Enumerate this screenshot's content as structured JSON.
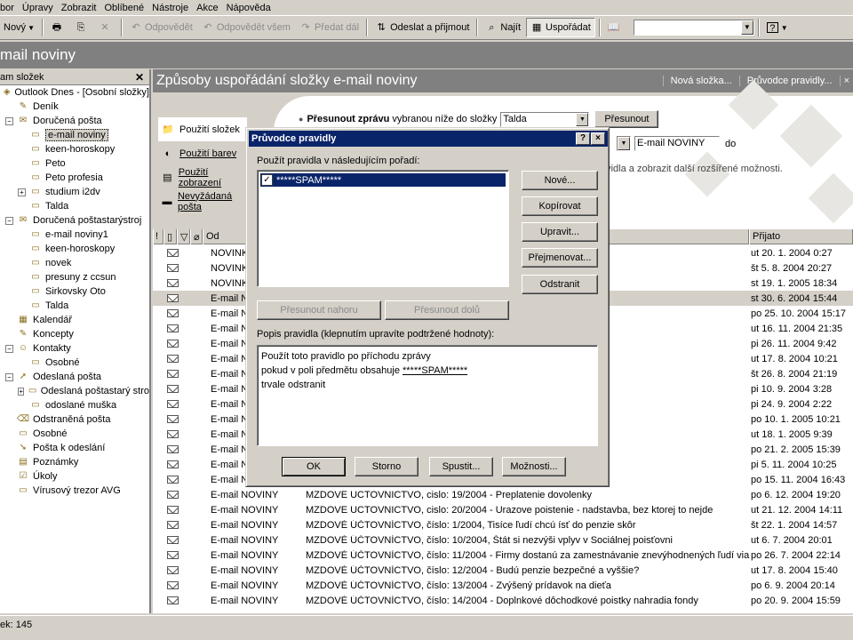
{
  "menu": [
    "bor",
    "Úpravy",
    "Zobrazit",
    "Oblíbené",
    "Nástroje",
    "Akce",
    "Nápověda"
  ],
  "toolbar": {
    "new": "Nový",
    "reply": "Odpovědět",
    "reply_all": "Odpovědět všem",
    "forward": "Předat dál",
    "send_receive": "Odeslat a přijmout",
    "find": "Najít",
    "organize": "Uspořádat"
  },
  "window_title": "mail noviny",
  "folder_pane": {
    "header": "am složek",
    "items": [
      {
        "label": "Outlook Dnes - [Osobní složky]",
        "indent": 0,
        "icon": "outlook-today-icon"
      },
      {
        "label": "Deník",
        "indent": 1,
        "icon": "journal-icon"
      },
      {
        "label": "Doručená pošta",
        "indent": 1,
        "icon": "inbox-icon",
        "expander": "−"
      },
      {
        "label": "e-mail noviny",
        "indent": 2,
        "icon": "folder-icon",
        "selected": true
      },
      {
        "label": "keen-horoskopy",
        "indent": 2,
        "icon": "folder-icon"
      },
      {
        "label": "Peto",
        "indent": 2,
        "icon": "folder-icon"
      },
      {
        "label": "Peto profesia",
        "indent": 2,
        "icon": "folder-icon"
      },
      {
        "label": "studium i2dv",
        "indent": 2,
        "icon": "folder-icon",
        "expander": "+"
      },
      {
        "label": "Talda",
        "indent": 2,
        "icon": "folder-icon"
      },
      {
        "label": "Doručená poštastarýstroj",
        "indent": 1,
        "icon": "inbox-icon",
        "expander": "−"
      },
      {
        "label": "e-mail noviny1",
        "indent": 2,
        "icon": "folder-icon"
      },
      {
        "label": "keen-horoskopy",
        "indent": 2,
        "icon": "folder-icon"
      },
      {
        "label": "novek",
        "indent": 2,
        "icon": "folder-icon"
      },
      {
        "label": "presuny z ccsun",
        "indent": 2,
        "icon": "folder-icon"
      },
      {
        "label": "Sirkovsky Oto",
        "indent": 2,
        "icon": "folder-icon"
      },
      {
        "label": "Talda",
        "indent": 2,
        "icon": "folder-icon"
      },
      {
        "label": "Kalendář",
        "indent": 1,
        "icon": "calendar-icon"
      },
      {
        "label": "Koncepty",
        "indent": 1,
        "icon": "drafts-icon"
      },
      {
        "label": "Kontakty",
        "indent": 1,
        "icon": "contacts-icon",
        "expander": "−"
      },
      {
        "label": "Osobné",
        "indent": 2,
        "icon": "folder-icon"
      },
      {
        "label": "Odeslaná pošta",
        "indent": 1,
        "icon": "sent-icon",
        "expander": "−"
      },
      {
        "label": "Odeslaná poštastarý stro",
        "indent": 2,
        "icon": "folder-icon",
        "expander": "+"
      },
      {
        "label": "odoslané muška",
        "indent": 2,
        "icon": "folder-icon"
      },
      {
        "label": "Odstraněná pošta",
        "indent": 1,
        "icon": "deleted-icon"
      },
      {
        "label": "Osobné",
        "indent": 1,
        "icon": "folder-icon"
      },
      {
        "label": "Pošta k odeslání",
        "indent": 1,
        "icon": "outbox-icon"
      },
      {
        "label": "Poznámky",
        "indent": 1,
        "icon": "notes-icon"
      },
      {
        "label": "Úkoly",
        "indent": 1,
        "icon": "tasks-icon"
      },
      {
        "label": "Vírusový trezor AVG",
        "indent": 1,
        "icon": "folder-icon"
      }
    ]
  },
  "organize": {
    "title": "Způsoby uspořádání složky e-mail noviny",
    "link_new_folder": "Nová složka...",
    "link_rules_wizard": "Průvodce pravidly...",
    "tabs": [
      "Použití složek",
      "Použití barev",
      "Použití zobrazení",
      "Nevyžádaná pošta"
    ],
    "move_label_bold": "Přesunout zprávu",
    "move_label_rest": "vybranou níže do složky",
    "move_folder_value": "Talda",
    "move_button": "Přesunout",
    "create_value": "E-mail NOVINY",
    "create_suffix": "do",
    "hint_text": "avidla a zobrazit další rozšířené možnosti."
  },
  "columns": {
    "from": "Od",
    "received": "Přijato"
  },
  "messages": [
    {
      "from": "NOVINK",
      "subject": "",
      "received": "ut 20. 1. 2004 0:27"
    },
    {
      "from": "NOVINK",
      "subject": "",
      "received": "št 5. 8. 2004 20:27"
    },
    {
      "from": "NOVINK",
      "subject": "",
      "received": "st 19. 1. 2005 18:34"
    },
    {
      "from": "E-mail N",
      "subject": "",
      "received": "st 30. 6. 2004 15:44",
      "highlight": true
    },
    {
      "from": "E-mail N",
      "subject": "zitie hromadnej korespondencie",
      "received": "po 25. 10. 2004 15:17"
    },
    {
      "from": "E-mail N",
      "subject": "",
      "received": "ut 16. 11. 2004 21:35"
    },
    {
      "from": "E-mail N",
      "subject": "v",
      "received": "pi 26. 11. 2004 9:42"
    },
    {
      "from": "E-mail N",
      "subject": "ových grafov",
      "received": "ut 17. 8. 2004 10:21"
    },
    {
      "from": "E-mail N",
      "subject": "chej kontingenčnej tabuľky",
      "received": "št 26. 8. 2004 21:19"
    },
    {
      "from": "E-mail N",
      "subject": "ľadov",
      "received": "pi 10. 9. 2004 3:28"
    },
    {
      "from": "E-mail N",
      "subject": "u z viacerých tabuliek",
      "received": "pi 24. 9. 2004 2:22"
    },
    {
      "from": "E-mail N",
      "subject": "odvodov?",
      "received": "po 10. 1. 2005 10:21"
    },
    {
      "from": "E-mail N",
      "subject": "",
      "received": "ut 18. 1. 2005 9:39"
    },
    {
      "from": "E-mail N",
      "subject": "avani",
      "received": "po 21. 2. 2005 15:39"
    },
    {
      "from": "E-mail N",
      "subject": "kovom sporeni",
      "received": "pi 5. 11. 2004 10:25"
    },
    {
      "from": "E-mail N",
      "subject": "vat aj SMS-kou",
      "received": "po 15. 11. 2004 16:43"
    },
    {
      "from": "E-mail NOVINY",
      "subject": "MZDOVE UCTOVNICTVO, cislo: 19/2004 - Preplatenie dovolenky",
      "received": "po 6. 12. 2004 19:20"
    },
    {
      "from": "E-mail NOVINY",
      "subject": "MZDOVE UCTOVNICTVO, cislo: 20/2004 - Urazove poistenie - nadstavba, bez ktorej to nejde",
      "received": "ut 21. 12. 2004 14:11"
    },
    {
      "from": "E-mail NOVINY",
      "subject": "MZDOVÉ ÚČTOVNÍCTVO, číslo: 1/2004, Tisíce ľudí chcú ísť do penzie skôr",
      "received": "št 22. 1. 2004 14:57"
    },
    {
      "from": "E-mail NOVINY",
      "subject": "MZDOVÉ ÚČTOVNÍCTVO, číslo: 10/2004, Štát si nezvýši vplyv v Sociálnej poisťovni",
      "received": "ut 6. 7. 2004 20:01"
    },
    {
      "from": "E-mail NOVINY",
      "subject": "MZDOVÉ ÚČTOVNÍCTVO, číslo: 11/2004 - Firmy dostanú za zamestnávanie znevýhodnených ľudí via...",
      "received": "po 26. 7. 2004 22:14"
    },
    {
      "from": "E-mail NOVINY",
      "subject": "MZDOVÉ ÚČTOVNÍCTVO, číslo: 12/2004 - Budú penzie bezpečné a vyššie?",
      "received": "ut 17. 8. 2004 15:40"
    },
    {
      "from": "E-mail NOVINY",
      "subject": "MZDOVÉ ÚČTOVNÍCTVO, číslo: 13/2004 - Zvýšený prídavok na dieťa",
      "received": "po 6. 9. 2004 20:14"
    },
    {
      "from": "E-mail NOVINY",
      "subject": "MZDOVÉ ÚČTOVNÍCTVO, číslo: 14/2004 - Doplnkové dôchodkové poistky nahradia fondy",
      "received": "po 20. 9. 2004 15:59"
    }
  ],
  "statusbar": "ek: 145",
  "dialog": {
    "title": "Průvodce pravidly",
    "help_btn": "?",
    "close_btn": "×",
    "order_label": "Použít pravidla v následujícím pořadí:",
    "rule_name": "*****SPAM*****",
    "btn_new": "Nové...",
    "btn_copy": "Kopírovat",
    "btn_edit": "Upravit...",
    "btn_rename": "Přejmenovat...",
    "btn_delete": "Odstranit",
    "btn_move_up": "Přesunout nahoru",
    "btn_move_down": "Přesunout dolů",
    "desc_label": "Popis pravidla (klepnutím upravíte podtržené hodnoty):",
    "desc_line1": "Použít toto pravidlo po příchodu zprávy",
    "desc_line2_pre": "pokud v poli předmětu obsahuje ",
    "desc_line2_link": "*****SPAM*****",
    "desc_line3": "trvale odstranit",
    "btn_ok": "OK",
    "btn_cancel": "Storno",
    "btn_run": "Spustit...",
    "btn_options": "Možnosti..."
  }
}
